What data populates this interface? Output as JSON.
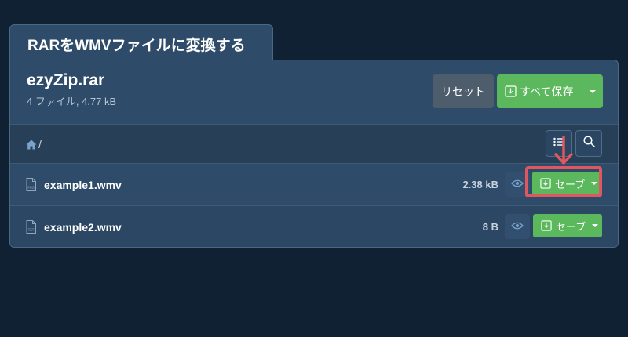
{
  "page": {
    "title": "RARをWMVファイルに変換する"
  },
  "archive": {
    "name": "ezyZip.rar",
    "info": "4 ファイル, 4.77 kB"
  },
  "actions": {
    "reset_label": "リセット",
    "save_all_label": "すべて保存"
  },
  "path": {
    "separator": "/"
  },
  "files": [
    {
      "name": "example1.wmv",
      "size": "2.38 kB",
      "save_label": "セーブ",
      "icon_type": "PNG"
    },
    {
      "name": "example2.wmv",
      "size": "8 B",
      "save_label": "セーブ",
      "icon_type": "TXT"
    }
  ],
  "colors": {
    "background": "#0f2133",
    "panel": "#2e4b69",
    "success": "#5cb85c",
    "reset": "#4e5d6c",
    "highlight": "#e0575f"
  },
  "icons": [
    "home-icon",
    "list-icon",
    "search-icon",
    "file-icon",
    "eye-icon",
    "download-icon",
    "caret-down-icon",
    "arrow-down-icon"
  ]
}
